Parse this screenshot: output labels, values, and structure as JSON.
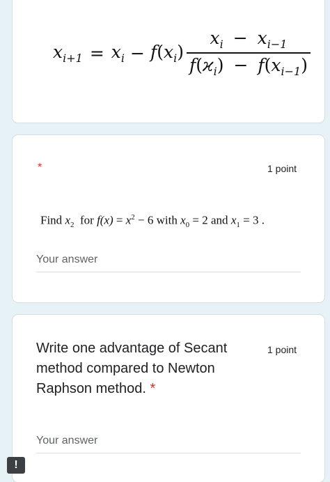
{
  "formula": {
    "lhs": "x",
    "lhs_sub": "i+1",
    "eq": "=",
    "x": "x",
    "x_sub": "i",
    "minus": "−",
    "f": "f",
    "num_a": "x",
    "num_a_sub": "i",
    "num_b": "x",
    "num_b_sub": "i−1",
    "den_f1": "f",
    "den_x1": "ϰ",
    "den_x1_sub": "i",
    "den_f2": "f",
    "den_x2": "x",
    "den_x2_sub": "i−1"
  },
  "question1": {
    "required_mark": "*",
    "points": "1 point",
    "find": "Find",
    "target_var": "x",
    "target_sub": "2",
    "for_text": "for",
    "func": "f(x)",
    "eq1": "=",
    "expr_base": "x",
    "expr_exp": "2",
    "expr_rest": "− 6",
    "with_text": "with",
    "x0": "x",
    "x0_sub": "0",
    "x0_val": "= 2",
    "and_text": "and",
    "x1": "x",
    "x1_sub": "1",
    "x1_val": "= 3 .",
    "answer_placeholder": "Your answer"
  },
  "question2": {
    "text": "Write one advantage of Secant method compared to Newton Raphson method.",
    "required_mark": "*",
    "points": "1 point",
    "answer_placeholder": "Your answer"
  },
  "report_button": {
    "label": "!"
  }
}
